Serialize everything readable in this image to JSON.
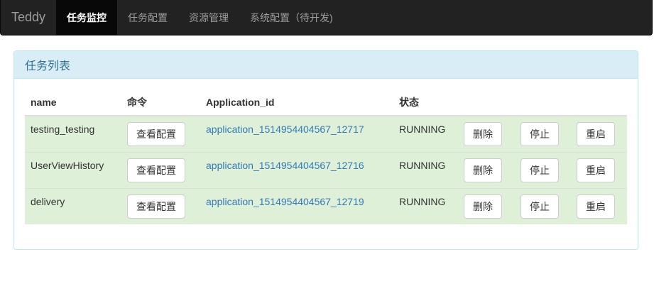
{
  "navbar": {
    "brand": "Teddy",
    "items": [
      {
        "label": "任务监控",
        "active": true
      },
      {
        "label": "任务配置",
        "active": false
      },
      {
        "label": "资源管理",
        "active": false
      },
      {
        "label": "系统配置（待开发)",
        "active": false
      }
    ]
  },
  "panel": {
    "title": "任务列表"
  },
  "table": {
    "headers": [
      "name",
      "命令",
      "Application_id",
      "状态"
    ],
    "rows": [
      {
        "name": "testing_testing",
        "command_button": "查看配置",
        "application_id": "application_1514954404567_12717",
        "status": "RUNNING",
        "delete_button": "删除",
        "stop_button": "停止",
        "restart_button": "重启"
      },
      {
        "name": "UserViewHistory",
        "command_button": "查看配置",
        "application_id": "application_1514954404567_12716",
        "status": "RUNNING",
        "delete_button": "删除",
        "stop_button": "停止",
        "restart_button": "重启"
      },
      {
        "name": "delivery",
        "command_button": "查看配置",
        "application_id": "application_1514954404567_12719",
        "status": "RUNNING",
        "delete_button": "删除",
        "stop_button": "停止",
        "restart_button": "重启"
      }
    ]
  },
  "colors": {
    "navbar_bg": "#222222",
    "panel_heading_bg": "#d9edf7",
    "row_success_bg": "#dff0d8",
    "link": "#337ab7"
  }
}
